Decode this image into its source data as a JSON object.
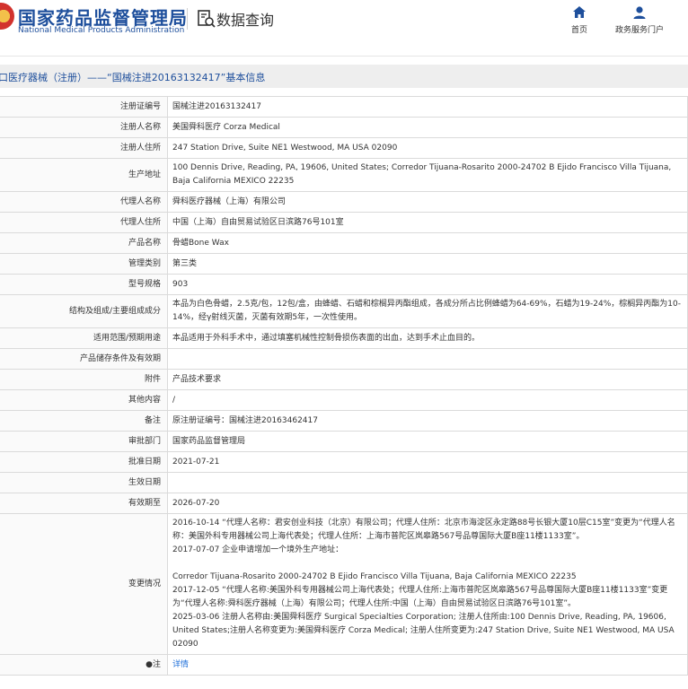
{
  "header": {
    "logo_cn": "国家药品监督管理局",
    "logo_en": "National Medical Products Administration",
    "query_title": "数据查询",
    "nav": [
      {
        "label": "首页",
        "icon": "home-icon"
      },
      {
        "label": "政务服务门户",
        "icon": "user-icon"
      }
    ]
  },
  "page_title": "口医疗器械（注册）——“国械注进20163132417”基本信息",
  "colors": {
    "brand_blue": "#1e4f9c",
    "link_blue": "#1e6fd9",
    "title_bg": "#eeeeee"
  },
  "rows": [
    {
      "label": "注册证编号",
      "value": "国械注进20163132417"
    },
    {
      "label": "注册人名称",
      "value": "美国舜科医疗 Corza Medical"
    },
    {
      "label": "注册人住所",
      "value": "247 Station Drive, Suite NE1 Westwood, MA USA 02090"
    },
    {
      "label": "生产地址",
      "value": "100 Dennis Drive, Reading, PA, 19606, United States; Corredor Tijuana-Rosarito 2000-24702 B Ejido Francisco Villa Tijuana, Baja California MEXICO 22235"
    },
    {
      "label": "代理人名称",
      "value": "舜科医疗器械（上海）有限公司"
    },
    {
      "label": "代理人住所",
      "value": "中国（上海）自由贸易试验区日滨路76号101室"
    },
    {
      "label": "产品名称",
      "value": "骨蜡Bone Wax"
    },
    {
      "label": "管理类别",
      "value": "第三类"
    },
    {
      "label": "型号规格",
      "value": "903"
    },
    {
      "label": "结构及组成/主要组成成分",
      "value": "本品为白色骨蜡，2.5克/包，12包/盒，由蜂蜡、石蜡和棕榈异丙酯组成，各成分所占比例蜂蜡为64-69%，石蜡为19-24%，棕榈异丙酯为10-14%，经γ射线灭菌，灭菌有效期5年，一次性使用。"
    },
    {
      "label": "适用范围/预期用途",
      "value": "本品适用于外科手术中，通过填塞机械性控制骨损伤表面的出血，达到手术止血目的。"
    },
    {
      "label": "产品储存条件及有效期",
      "value": ""
    },
    {
      "label": "附件",
      "value": "产品技术要求"
    },
    {
      "label": "其他内容",
      "value": "/"
    },
    {
      "label": "备注",
      "value": "原注册证编号：国械注进20163462417"
    },
    {
      "label": "审批部门",
      "value": "国家药品监督管理局"
    },
    {
      "label": "批准日期",
      "value": "2021-07-21"
    },
    {
      "label": "生效日期",
      "value": ""
    },
    {
      "label": "有效期至",
      "value": "2026-07-20"
    }
  ],
  "change": {
    "label": "变更情况",
    "lines": [
      "2016-10-14 “代理人名称：君安创业科技（北京）有限公司；代理人住所：北京市海淀区永定路88号长银大厦10层C15室”变更为“代理人名称：美国外科专用器械公司上海代表处；代理人住所：上海市普陀区岚皋路567号品尊国际大厦B座11楼1133室”。",
      "2017-07-07 企业申请增加一个境外生产地址：",
      "",
      "Corredor Tijuana-Rosarito 2000-24702 B Ejido Francisco Villa Tijuana, Baja California MEXICO 22235",
      "2017-12-05 “代理人名称:美国外科专用器械公司上海代表处；代理人住所:上海市普陀区岚皋路567号品尊国际大厦B座11楼1133室”变更为“代理人名称:舜科医疗器械（上海）有限公司；代理人住所:中国（上海）自由贸易试验区日滨路76号101室”。",
      "2025-03-06 注册人名称由:美国舜科医疗 Surgical Specialties Corporation; 注册人住所由:100 Dennis Drive, Reading, PA, 19606, United States;注册人名称变更为:美国舜科医疗 Corza Medical; 注册人住所变更为:247 Station Drive, Suite NE1 Westwood, MA USA 02090"
    ]
  },
  "note": {
    "label": "注",
    "link_text": "详情"
  }
}
